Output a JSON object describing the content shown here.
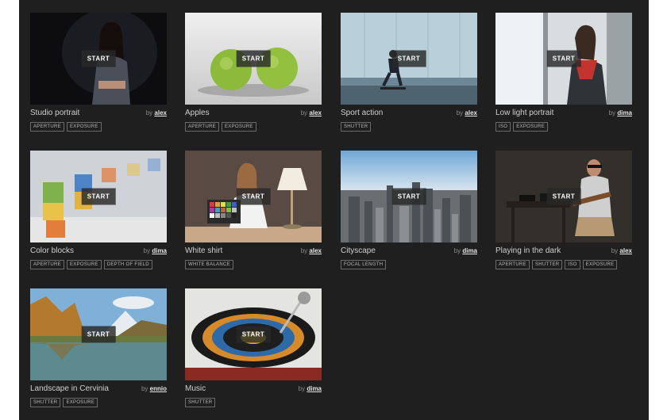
{
  "cards": [
    {
      "title": "Studio portrait",
      "by": "by",
      "author": "alex",
      "start": "START",
      "tags": [
        "APERTURE",
        "EXPOSURE"
      ]
    },
    {
      "title": "Apples",
      "by": "by",
      "author": "alex",
      "start": "START",
      "tags": [
        "APERTURE",
        "EXPOSURE"
      ]
    },
    {
      "title": "Sport action",
      "by": "by",
      "author": "alex",
      "start": "START",
      "tags": [
        "SHUTTER"
      ]
    },
    {
      "title": "Low light portrait",
      "by": "by",
      "author": "dima",
      "start": "START",
      "tags": [
        "ISO",
        "EXPOSURE"
      ]
    },
    {
      "title": "Color blocks",
      "by": "by",
      "author": "dima",
      "start": "START",
      "tags": [
        "APERTURE",
        "EXPOSURE",
        "DEPTH OF FIELD"
      ]
    },
    {
      "title": "White shirt",
      "by": "by",
      "author": "alex",
      "start": "START",
      "tags": [
        "WHITE BALANCE"
      ]
    },
    {
      "title": "Cityscape",
      "by": "by",
      "author": "dima",
      "start": "START",
      "tags": [
        "FOCAL LENGTH"
      ]
    },
    {
      "title": "Playing in the dark",
      "by": "by",
      "author": "alex",
      "start": "START",
      "tags": [
        "APERTURE",
        "SHUTTER",
        "ISO",
        "EXPOSURE"
      ]
    },
    {
      "title": "Landscape in Cervinia",
      "by": "by",
      "author": "ennio",
      "start": "START",
      "tags": [
        "SHUTTER",
        "EXPOSURE"
      ]
    },
    {
      "title": "Music",
      "by": "by",
      "author": "dima",
      "start": "START",
      "tags": [
        "SHUTTER"
      ]
    }
  ],
  "colors": {
    "panel": "#1f1f1f",
    "start_bg": "#282828",
    "tag_border": "#6a6a6a"
  }
}
